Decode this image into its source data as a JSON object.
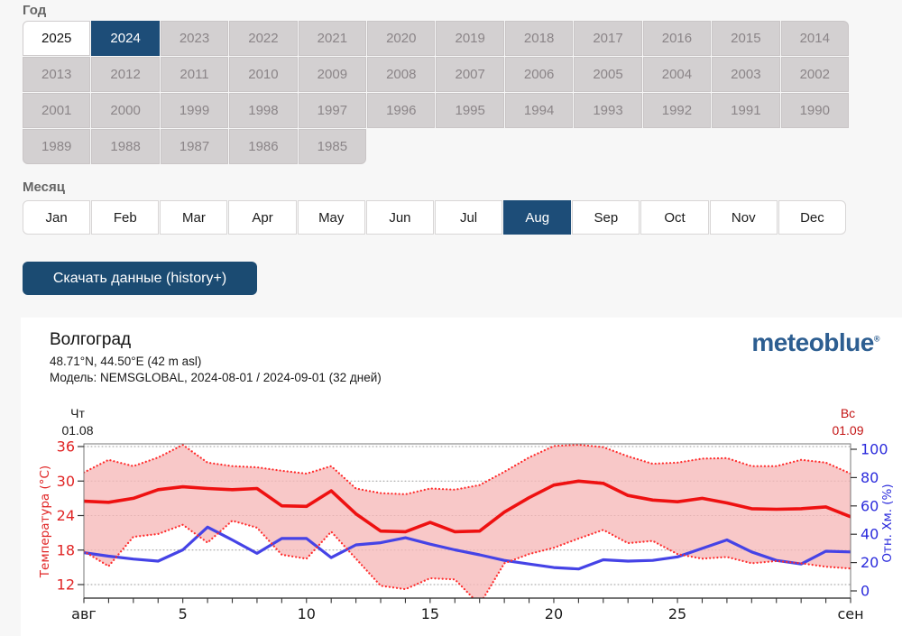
{
  "page": {
    "background": "#f7f7f7",
    "accent": "#1d4d78"
  },
  "year_section": {
    "label": "Год",
    "selected": "2024",
    "highlighted": "2025",
    "rows": [
      [
        "2025",
        "2024",
        "2023",
        "2022",
        "2021",
        "2020",
        "2019",
        "2018",
        "2017",
        "2016",
        "2015",
        "2014"
      ],
      [
        "2013",
        "2012",
        "2011",
        "2010",
        "2009",
        "2008",
        "2007",
        "2006",
        "2005",
        "2004",
        "2003",
        "2002"
      ],
      [
        "2001",
        "2000",
        "1999",
        "1998",
        "1997",
        "1996",
        "1995",
        "1994",
        "1993",
        "1992",
        "1991",
        "1990"
      ],
      [
        "1989",
        "1988",
        "1987",
        "1986",
        "1985"
      ]
    ]
  },
  "month_section": {
    "label": "Месяц",
    "selected": "Aug",
    "months": [
      "Jan",
      "Feb",
      "Mar",
      "Apr",
      "May",
      "Jun",
      "Jul",
      "Aug",
      "Sep",
      "Oct",
      "Nov",
      "Dec"
    ]
  },
  "download_button": {
    "label": "Скачать данные (history+)"
  },
  "chart_panel": {
    "title": "Волгоград",
    "location": "48.71°N, 44.50°E (42 m asl)",
    "model": "Модель: NEMSGLOBAL, 2024-08-01 / 2024-09-01 (32 дней)",
    "brand": "meteoblue",
    "brand_mark": "®",
    "start_label": {
      "weekday": "Чт",
      "date": "01.08"
    },
    "end_label": {
      "weekday": "Вс",
      "date": "01.09"
    }
  },
  "chart_data": {
    "type": "line",
    "title": "Волгоград — NEMSGLOBAL 2024-08-01 / 2024-09-01",
    "x_days": [
      1,
      2,
      3,
      4,
      5,
      6,
      7,
      8,
      9,
      10,
      11,
      12,
      13,
      14,
      15,
      16,
      17,
      18,
      19,
      20,
      21,
      22,
      23,
      24,
      25,
      26,
      27,
      28,
      29,
      30,
      31,
      32
    ],
    "x_tick_labels": [
      {
        "day": 1,
        "label": "авг"
      },
      {
        "day": 5,
        "label": "5"
      },
      {
        "day": 10,
        "label": "10"
      },
      {
        "day": 15,
        "label": "15"
      },
      {
        "day": 20,
        "label": "20"
      },
      {
        "day": 25,
        "label": "25"
      },
      {
        "day": 32,
        "label": "сен"
      }
    ],
    "left_axis": {
      "label": "Температура (°C)",
      "ticks": [
        36,
        30,
        24,
        18,
        12
      ],
      "color": "#e02424",
      "top_value": 36.5,
      "bottom_value": 9.65,
      "grid": true
    },
    "right_axis": {
      "label": "Отн. Хм. (%)",
      "ticks": [
        100,
        80,
        60,
        40,
        20,
        0
      ],
      "color": "#2b2bdc",
      "top_value": 102.4,
      "bottom_value": -5.1,
      "grid": false
    },
    "series": [
      {
        "name": "temperature-mean",
        "axis": "left",
        "style": "solid",
        "color": "#ee1111",
        "values": [
          26.5,
          26.3,
          27.0,
          28.5,
          29.0,
          28.7,
          28.5,
          28.7,
          25.7,
          25.6,
          28.3,
          24.3,
          21.3,
          21.2,
          22.8,
          21.2,
          21.3,
          24.6,
          27.1,
          29.3,
          30.0,
          29.6,
          27.5,
          26.7,
          26.4,
          27.0,
          26.2,
          25.2,
          25.1,
          25.2,
          25.5,
          23.8
        ]
      },
      {
        "name": "temperature-max",
        "axis": "left",
        "style": "dotted",
        "color": "#ff2d2d",
        "values": [
          31.5,
          33.7,
          32.6,
          34.1,
          36.3,
          33.2,
          32.6,
          32.4,
          31.8,
          31.3,
          32.6,
          28.7,
          27.9,
          27.7,
          28.7,
          28.5,
          29.3,
          31.6,
          34.1,
          36.1,
          36.3,
          35.9,
          34.3,
          33.0,
          33.2,
          33.9,
          34.0,
          32.6,
          32.6,
          33.7,
          33.2,
          31.3
        ]
      },
      {
        "name": "temperature-min",
        "axis": "left",
        "style": "dotted",
        "color": "#ff2d2d",
        "values": [
          17.8,
          15.2,
          20.3,
          20.8,
          22.4,
          19.3,
          23.1,
          21.9,
          17.2,
          16.5,
          21.2,
          16.5,
          11.8,
          11.2,
          13.1,
          12.9,
          8.5,
          15.7,
          17.3,
          18.4,
          20.0,
          21.5,
          19.2,
          19.6,
          17.3,
          16.5,
          16.8,
          15.7,
          16.1,
          15.7,
          15.1,
          14.8
        ]
      },
      {
        "name": "relative-humidity",
        "axis": "right",
        "style": "solid",
        "color": "#4543e6",
        "values": [
          27,
          24.5,
          22.5,
          21,
          29,
          45,
          36,
          26.5,
          37,
          37,
          23.5,
          32.5,
          34,
          37.5,
          33,
          29,
          25.5,
          21.5,
          19,
          16.5,
          15.5,
          22,
          21,
          21.5,
          24,
          30,
          36,
          27.5,
          21.5,
          19,
          28,
          27.5
        ]
      }
    ],
    "band": {
      "upper": "temperature-max",
      "lower": "temperature-min",
      "fill": "#f6b9b9",
      "opacity": 0.78
    }
  }
}
